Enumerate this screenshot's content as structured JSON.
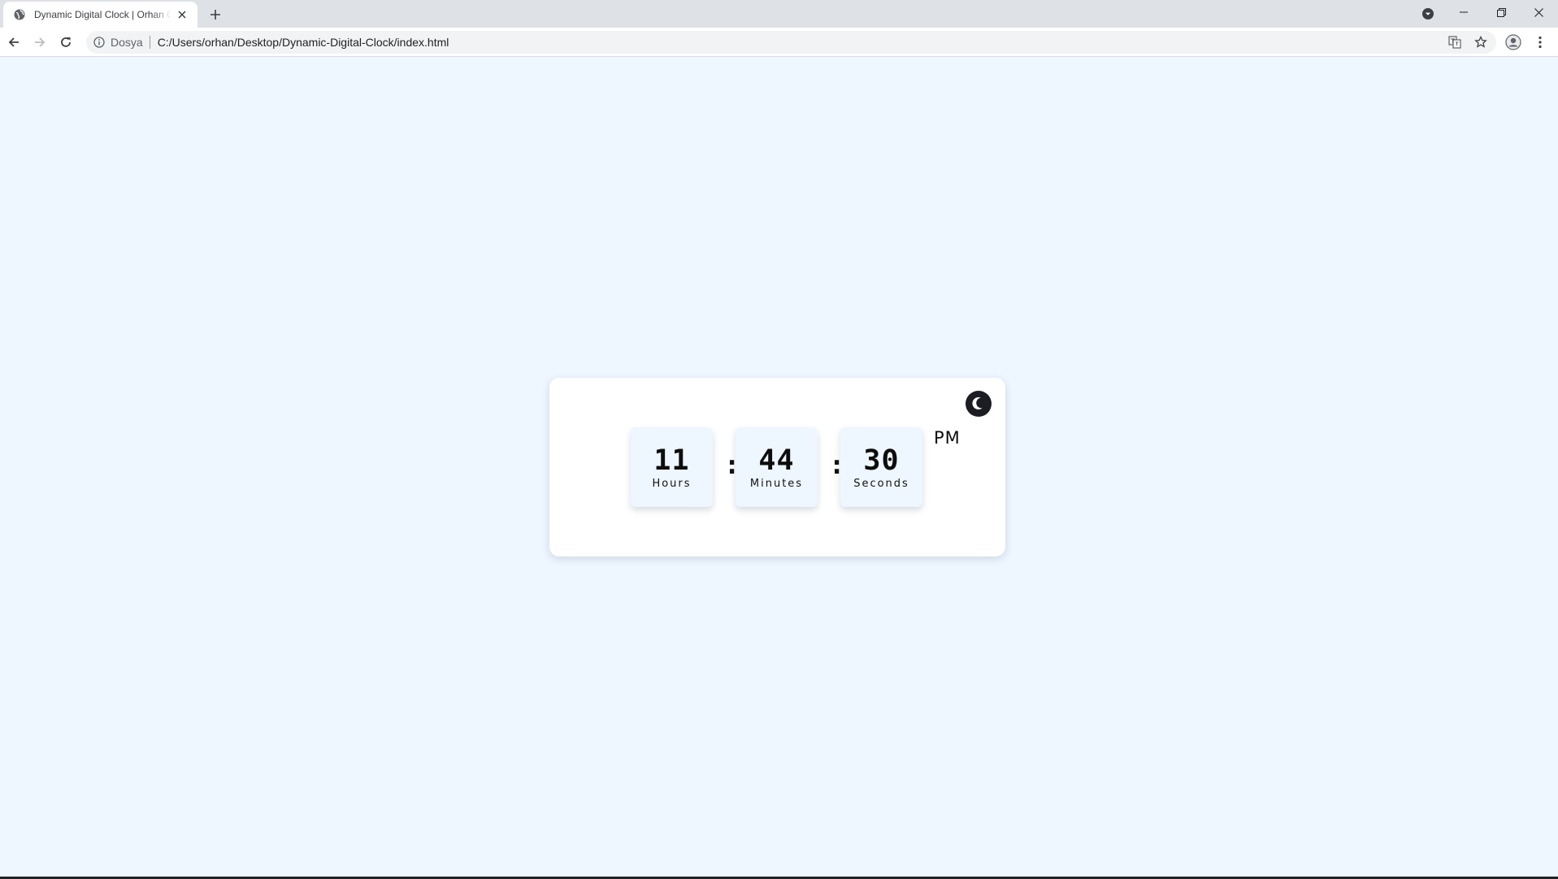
{
  "browser": {
    "tab_title": "Dynamic Digital Clock | Orhan Özdemir",
    "url_scheme_label": "Dosya",
    "url": "C:/Users/orhan/Desktop/Dynamic-Digital-Clock/index.html"
  },
  "clock": {
    "hours": "11",
    "hours_label": "Hours",
    "minutes": "44",
    "minutes_label": "Minutes",
    "seconds": "30",
    "seconds_label": "Seconds",
    "separator": ":",
    "period": "PM",
    "theme_toggle_icon": "moon-icon"
  },
  "colors": {
    "page_background": "#eef6ff",
    "card_background": "#ffffff",
    "toggle_background": "#1b1d22"
  }
}
